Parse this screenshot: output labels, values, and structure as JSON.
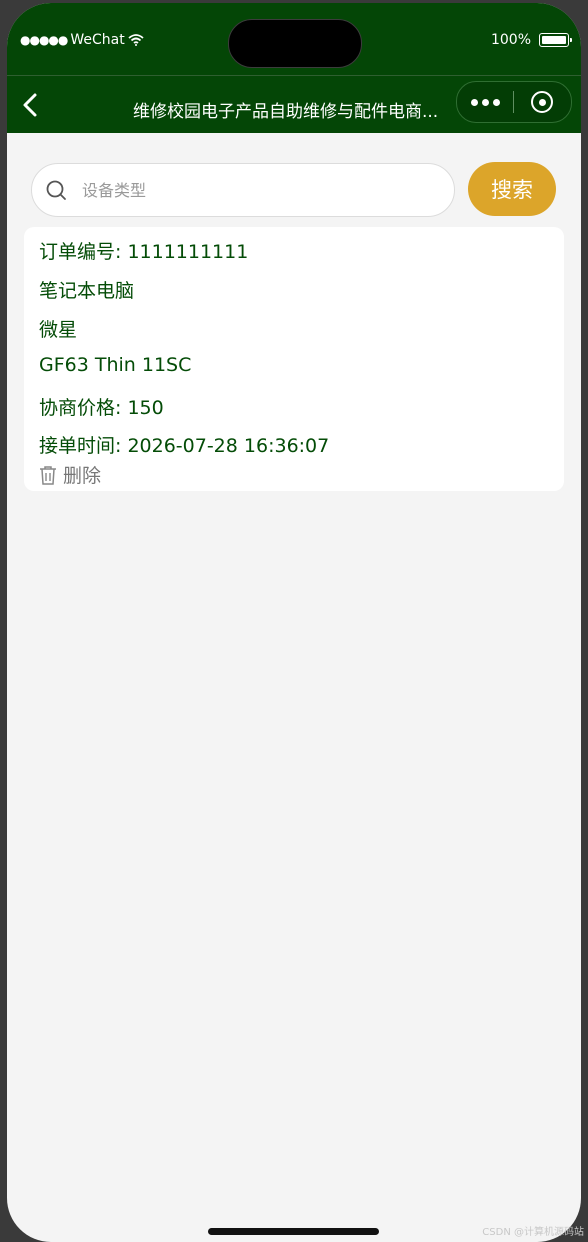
{
  "status_bar": {
    "signal": "●●●●●",
    "carrier": "WeChat",
    "battery_percent": "100%"
  },
  "nav": {
    "title": "维修校园电子产品自助维修与配件电商...",
    "back_icon": "chevron-left-icon",
    "more_icon": "more-dots-icon",
    "close_icon": "target-circle-icon"
  },
  "search": {
    "placeholder": "设备类型",
    "value": "",
    "button_label": "搜索"
  },
  "order": {
    "number": "订单编号: 1111111111",
    "device_type": "笔记本电脑",
    "brand": "微星",
    "model": "GF63 Thin 11SC",
    "price": "协商价格: 150",
    "accept_time": "接单时间: 2026-07-28 16:36:07",
    "delete_label": "删除"
  },
  "watermark": "CSDN @计算机源码站",
  "colors": {
    "header_bg": "#044606",
    "accent_button": "#dca52a",
    "text_green": "#044c07",
    "page_bg": "#f4f4f4"
  }
}
